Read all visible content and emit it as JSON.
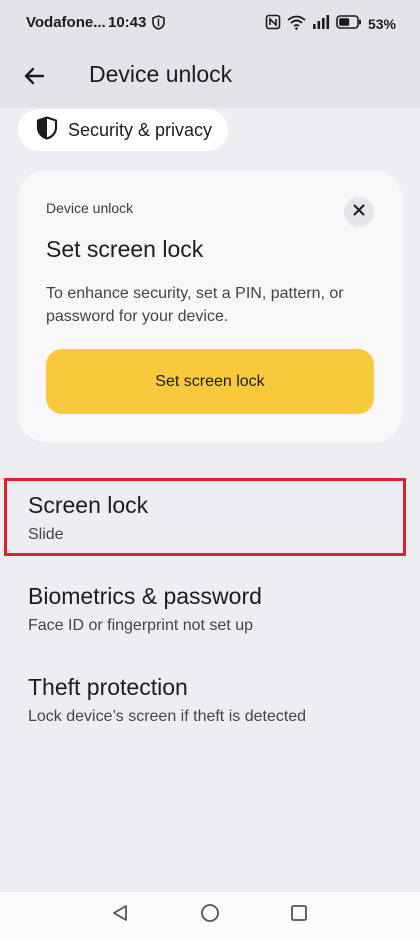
{
  "status_bar": {
    "carrier": "Vodafone...",
    "time": "10:43",
    "battery": "53%"
  },
  "app_bar": {
    "title": "Device unlock"
  },
  "breadcrumb": {
    "label": "Security & privacy"
  },
  "card": {
    "eyebrow": "Device unlock",
    "title": "Set screen lock",
    "description": "To enhance security, set a PIN, pattern, or password for your device.",
    "button_label": "Set screen lock",
    "button_color": "#f8c93a"
  },
  "items": [
    {
      "title": "Screen lock",
      "subtitle": "Slide"
    },
    {
      "title": "Biometrics & password",
      "subtitle": "Face ID or fingerprint not set up"
    },
    {
      "title": "Theft protection",
      "subtitle": "Lock device’s screen if theft is detected"
    }
  ],
  "highlight_color": "#e0202b",
  "icons": {
    "back": "arrow-left-icon",
    "shield": "shield-icon",
    "close": "close-icon",
    "nav_back": "triangle-back-icon",
    "nav_home": "circle-home-icon",
    "nav_recents": "square-recents-icon"
  }
}
